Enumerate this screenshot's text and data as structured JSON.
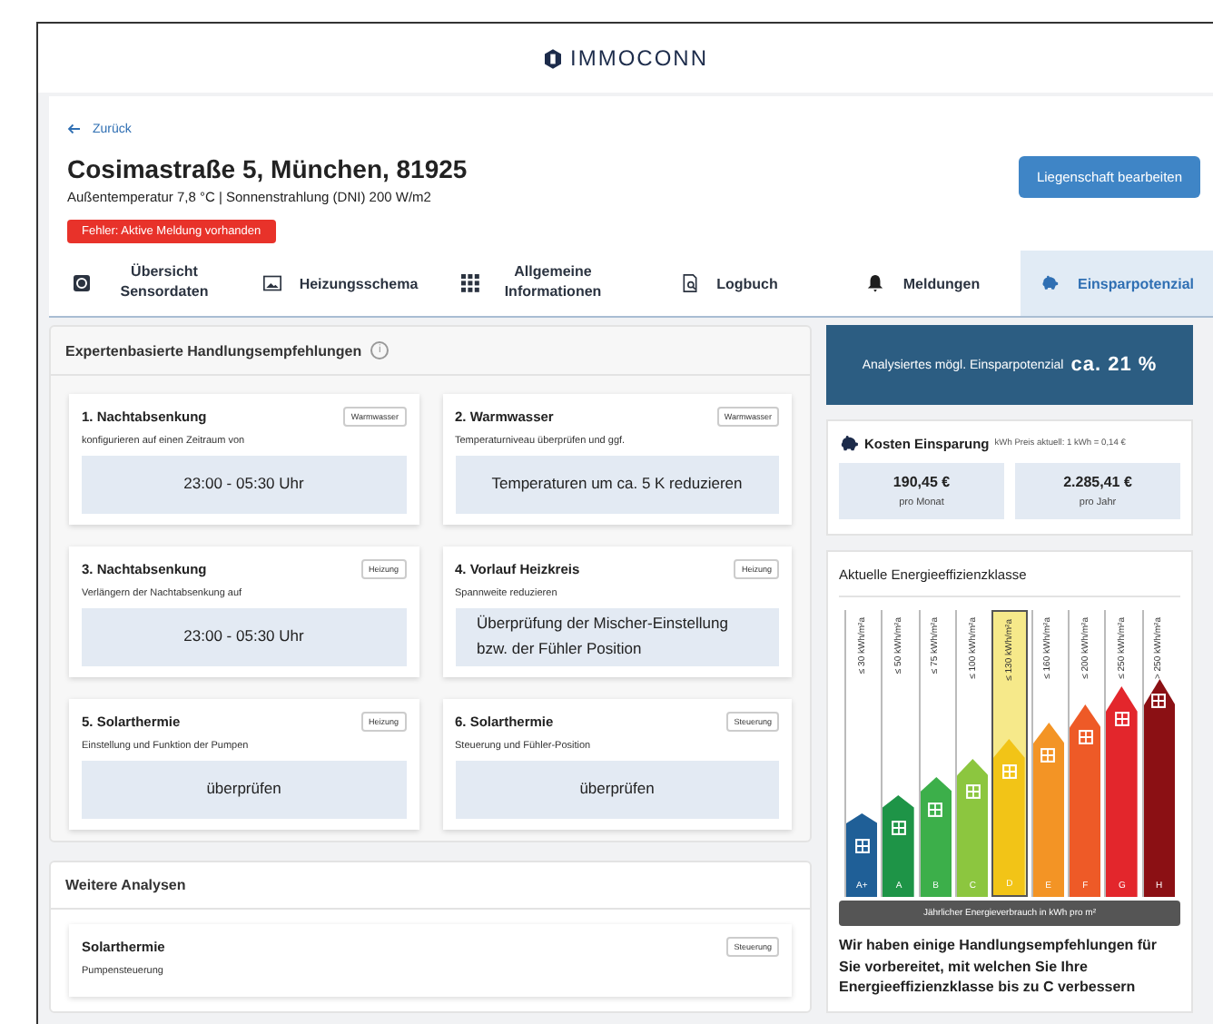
{
  "header": {
    "logo": "IMMOCONN"
  },
  "back_link": "Zurück",
  "property": {
    "title": "Cosimastraße 5, München, 81925",
    "subtitle": "Außentemperatur 7,8 °C | Sonnenstrahlung (DNI) 200 W/m2",
    "error_badge": "Fehler: Aktive Meldung vorhanden",
    "edit_button": "Liegenschaft bearbeiten"
  },
  "tabs": [
    {
      "label": "Übersicht Sensordaten",
      "kind": "sensor",
      "selected": false
    },
    {
      "label": "Heizungsschema",
      "kind": "diagram",
      "selected": false
    },
    {
      "label": "Allgemeine Informationen",
      "kind": "grid",
      "selected": false
    },
    {
      "label": "Logbuch",
      "kind": "log",
      "selected": false
    },
    {
      "label": "Meldungen",
      "kind": "bell",
      "selected": false
    },
    {
      "label": "Einsparpotenzial",
      "kind": "piggy",
      "selected": true
    }
  ],
  "recommendations": {
    "title": "Expertenbasierte Handlungsempfehlungen",
    "info_icon": "i",
    "cards": [
      {
        "title": "1. Nachtabsenkung",
        "tag": "Warmwasser",
        "description": "konfigurieren auf einen Zeitraum von",
        "action": "23:00 - 05:30 Uhr"
      },
      {
        "title": "2. Warmwasser",
        "tag": "Warmwasser",
        "description": "Temperaturniveau überprüfen und ggf.",
        "action": "Temperaturen um ca. 5 K reduzieren"
      },
      {
        "title": "3. Nachtabsenkung",
        "tag": "Heizung",
        "description": "Verlängern der Nachtabsenkung auf",
        "action": "23:00 - 05:30 Uhr"
      },
      {
        "title": "4. Vorlauf Heizkreis",
        "tag": "Heizung",
        "description": "Spannweite reduzieren",
        "action": "Überprüfung der Mischer-Einstellung bzw. der Fühler Position"
      },
      {
        "title": "5. Solarthermie",
        "tag": "Heizung",
        "description": "Einstellung und Funktion der Pumpen",
        "action": "überprüfen"
      },
      {
        "title": "6. Solarthermie",
        "tag": "Steuerung",
        "description": "Steuerung und Fühler-Position",
        "action": "überprüfen"
      }
    ]
  },
  "further": {
    "title": "Weitere Analysen",
    "items": [
      {
        "title": "Solarthermie",
        "tag": "Steuerung",
        "description": "Pumpensteuerung"
      }
    ]
  },
  "savings": {
    "label": "Analysiertes mögl. Einsparpotenzial",
    "value": "ca. 21 %"
  },
  "costs": {
    "title": "Kosten Einsparung",
    "note": "kWh Preis aktuell: 1 kWh = 0,14 €",
    "figures": [
      {
        "value": "190,45 €",
        "unit": "pro Monat"
      },
      {
        "value": "2.285,41 €",
        "unit": "pro Jahr"
      }
    ]
  },
  "efficiency": {
    "title": "Aktuelle Energieeffizienzklasse",
    "classes": [
      {
        "letter": "A+",
        "range": "≤ 30 kWh/m²a",
        "color": "#1f5f97",
        "selected": false
      },
      {
        "letter": "A",
        "range": "≤ 50 kWh/m²a",
        "color": "#1e9447",
        "selected": false
      },
      {
        "letter": "B",
        "range": "≤ 75 kWh/m²a",
        "color": "#3caf4a",
        "selected": false
      },
      {
        "letter": "C",
        "range": "≤ 100 kWh/m²a",
        "color": "#8cc63f",
        "selected": false
      },
      {
        "letter": "D",
        "range": "≤ 130 kWh/m²a",
        "color": "#f2c417",
        "selected": true
      },
      {
        "letter": "E",
        "range": "≤ 160 kWh/m²a",
        "color": "#f39425",
        "selected": false
      },
      {
        "letter": "F",
        "range": "≤ 200 kWh/m²a",
        "color": "#ee5a27",
        "selected": false
      },
      {
        "letter": "G",
        "range": "≤ 250 kWh/m²a",
        "color": "#e3262c",
        "selected": false
      },
      {
        "letter": "H",
        "range": "> 250 kWh/m²a",
        "color": "#8b1014",
        "selected": false
      }
    ],
    "axis_label": "Jährlicher Energieverbrauch in kWh pro m²",
    "message": "Wir haben einige Handlungsempfehlungen für Sie vorbereitet, mit welchen Sie Ihre Energieeffizienzklasse bis zu C verbessern"
  }
}
